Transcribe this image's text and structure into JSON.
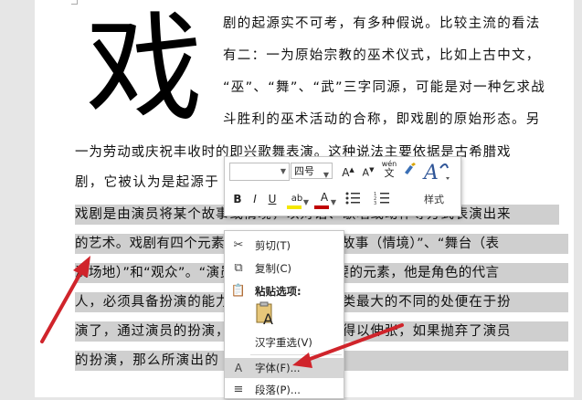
{
  "document": {
    "big_char": "戏",
    "lines": [
      "剧的起源实不可考，有多种假说。比较主流的看法",
      "有二：一为原始宗教的巫术仪式，比如上古中文，",
      "“巫”、“舞”、“武”三字同源，可能是对一种乞求战",
      "斗胜利的巫术活动的合称，即戏剧的原始形态。另",
      "一为劳动或庆祝丰收时的即兴歌舞表演。这种说法主要依据是古希腊戏",
      "剧，它被认为是起源于",
      "戏剧是由演员将某个故事或情境，以对话、歌唱或动作等方式表演出来",
      "的艺术。戏剧有四个元素，包括了“演员”、“故事（情境）”、“舞台（表",
      "演场地）”和“观众”。“演员”是四者当中最重要的元素，他是角色的代言",
      "人，必须具备扮演的能力，戏剧与其他艺术类最大的不同的处便在于扮",
      "演了，通过演员的扮演，剧本中的角色才能得以伸张，如果抛弃了演员",
      "的扮演，那么所演出的"
    ]
  },
  "mini_toolbar": {
    "font_name": "",
    "font_size": "四号",
    "grow_font": "A",
    "shrink_font": "A",
    "phonetic_top": "wén",
    "phonetic_bottom": "文",
    "bold": "B",
    "italic": "I",
    "underline": "U",
    "highlight": "ab",
    "font_color": "A",
    "styles_label": "样式",
    "highlight_color": "#f4e700",
    "font_color_value": "#c00000"
  },
  "context_menu": {
    "items": [
      {
        "label": "剪切(T)",
        "icon": "scissors-icon"
      },
      {
        "label": "复制(C)",
        "icon": "copy-icon"
      },
      {
        "label": "粘贴选项:",
        "icon": "paste-icon"
      },
      {
        "label": "汉字重选(V)",
        "icon": ""
      },
      {
        "label": "字体(F)...",
        "icon": "font-icon"
      },
      {
        "label": "段落(P)...",
        "icon": "paragraph-icon"
      }
    ],
    "paste_glyph": "A"
  },
  "colors": {
    "selection": "#cfcfcf",
    "arrow": "#d0242b",
    "menu_hover": "#d6d6d6"
  }
}
